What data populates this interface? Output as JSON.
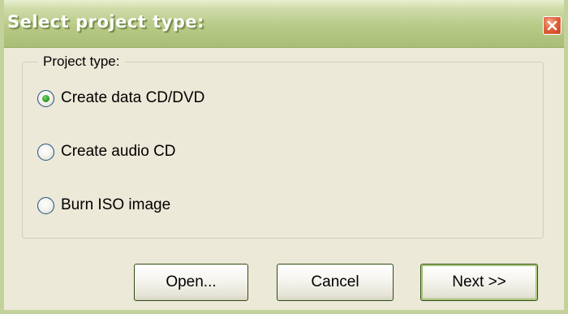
{
  "window": {
    "title": "Select project type:"
  },
  "icons": {
    "close": "close-icon"
  },
  "group": {
    "label": "Project type:"
  },
  "options": [
    {
      "label": "Create data CD/DVD",
      "selected": true
    },
    {
      "label": "Create audio CD",
      "selected": false
    },
    {
      "label": "Burn ISO image",
      "selected": false
    }
  ],
  "buttons": {
    "open": "Open...",
    "cancel": "Cancel",
    "next": "Next >>"
  },
  "colors": {
    "titlebar": "#b8ca87",
    "dialog_bg": "#ece9d8",
    "close_button": "#e2623c",
    "radio_selected": "#35a02d"
  }
}
